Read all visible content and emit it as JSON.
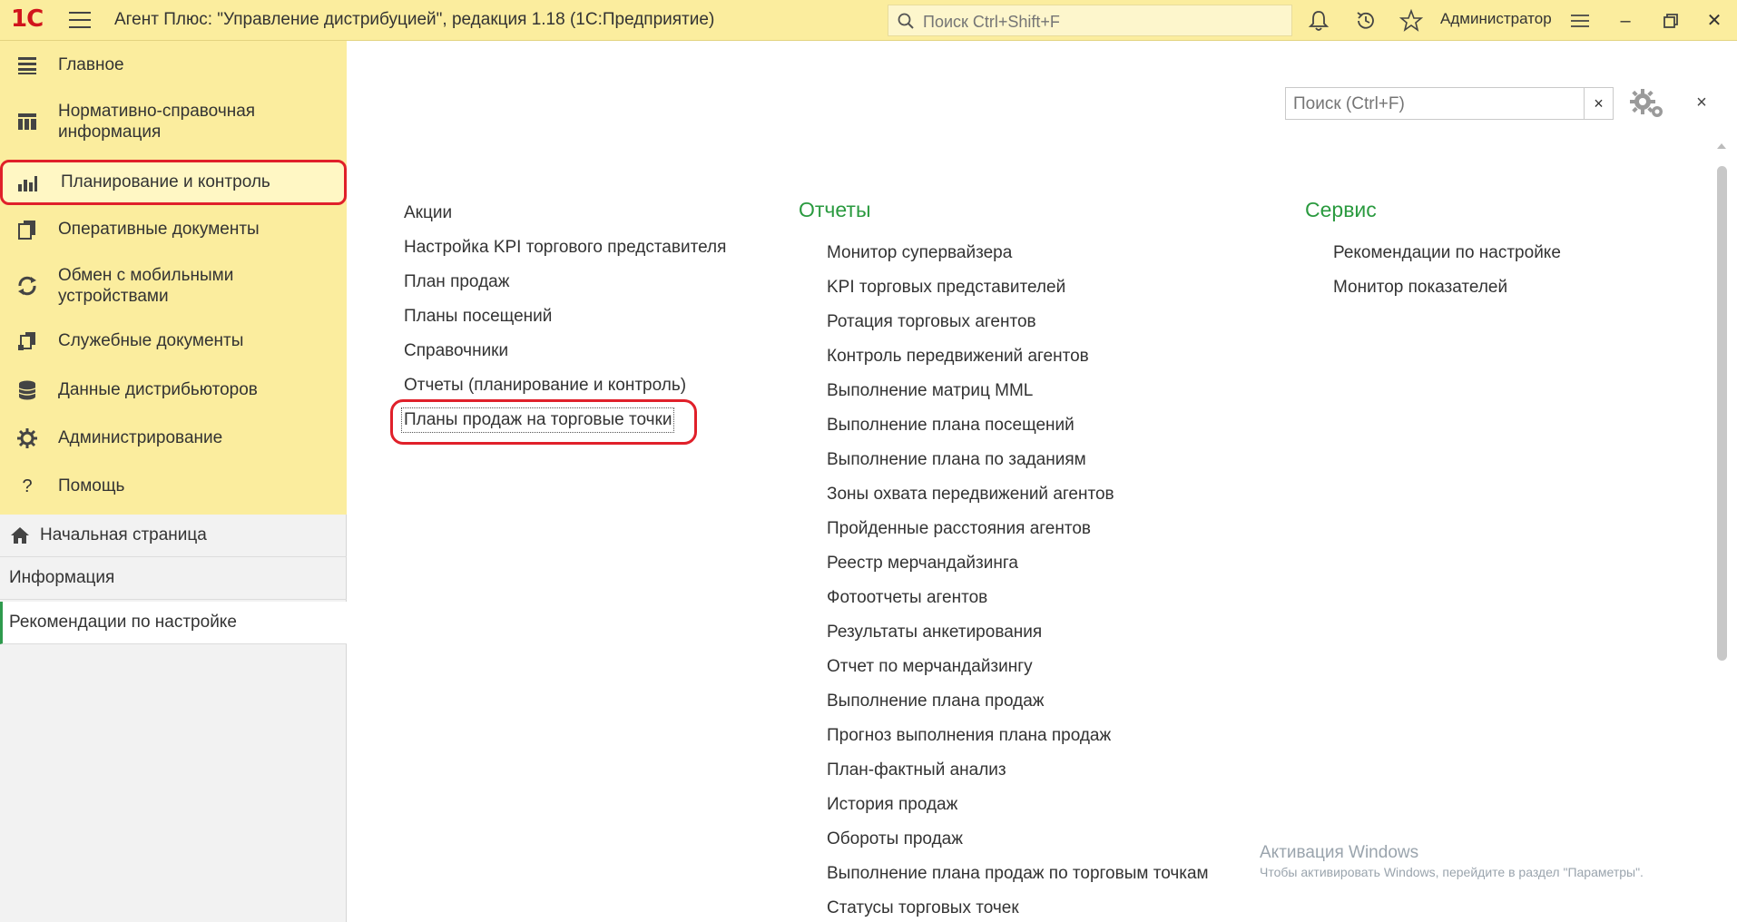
{
  "titlebar": {
    "logo": "1С",
    "title": "Агент Плюс: \"Управление дистрибуцией\", редакция 1.18  (1С:Предприятие)",
    "search_placeholder": "Поиск Ctrl+Shift+F",
    "user": "Администратор"
  },
  "sidebar": {
    "sections": [
      {
        "label": "Главное",
        "icon": "menu-lines-icon"
      },
      {
        "label": "Нормативно-справочная\nинформация",
        "icon": "grid-table-icon"
      },
      {
        "label": "Планирование и контроль",
        "icon": "bar-chart-icon",
        "active": true
      },
      {
        "label": "Оперативные документы",
        "icon": "documents-icon"
      },
      {
        "label": "Обмен с мобильными\nустройствами",
        "icon": "sync-icon"
      },
      {
        "label": "Служебные документы",
        "icon": "service-docs-icon"
      },
      {
        "label": "Данные дистрибьюторов",
        "icon": "database-icon"
      },
      {
        "label": "Администрирование",
        "icon": "gear-icon"
      },
      {
        "label": "Помощь",
        "icon": "question-icon"
      }
    ],
    "history": [
      {
        "label": "Начальная страница"
      },
      {
        "label": "Информация"
      },
      {
        "label": "Рекомендации по настройке"
      }
    ]
  },
  "panel": {
    "search_placeholder": "Поиск (Ctrl+F)",
    "clear_label": "×",
    "close_label": "×",
    "col1": [
      "Акции",
      "Настройка KPI торгового представителя",
      "План продаж",
      "Планы посещений",
      "Справочники",
      "Отчеты (планирование и контроль)",
      "Планы продаж на торговые точки"
    ],
    "col2_title": "Отчеты",
    "col2": [
      "Монитор супервайзера",
      "KPI торговых представителей",
      "Ротация торговых агентов",
      "Контроль передвижений агентов",
      "Выполнение матриц MML",
      "Выполнение плана посещений",
      "Выполнение плана по заданиям",
      "Зоны охвата передвижений агентов",
      "Пройденные расстояния агентов",
      "Реестр мерчандайзинга",
      "Фотоотчеты агентов",
      "Результаты анкетирования",
      "Отчет по  мерчандайзингу",
      "Выполнение плана продаж",
      "Прогноз выполнения плана продаж",
      "План-фактный анализ",
      "История продаж",
      "Обороты продаж",
      "Выполнение плана продаж по торговым точкам",
      "Статусы торговых точек"
    ],
    "col3_title": "Сервис",
    "col3": [
      "Рекомендации по настройке",
      "Монитор показателей"
    ]
  },
  "watermark": {
    "title": "Активация Windows",
    "subtitle": "Чтобы активировать Windows, перейдите в раздел \"Параметры\"."
  },
  "colors": {
    "titlebar_bg": "#fbed9e",
    "accent_green": "#2a9a3f",
    "highlight_red": "#e0202a"
  }
}
